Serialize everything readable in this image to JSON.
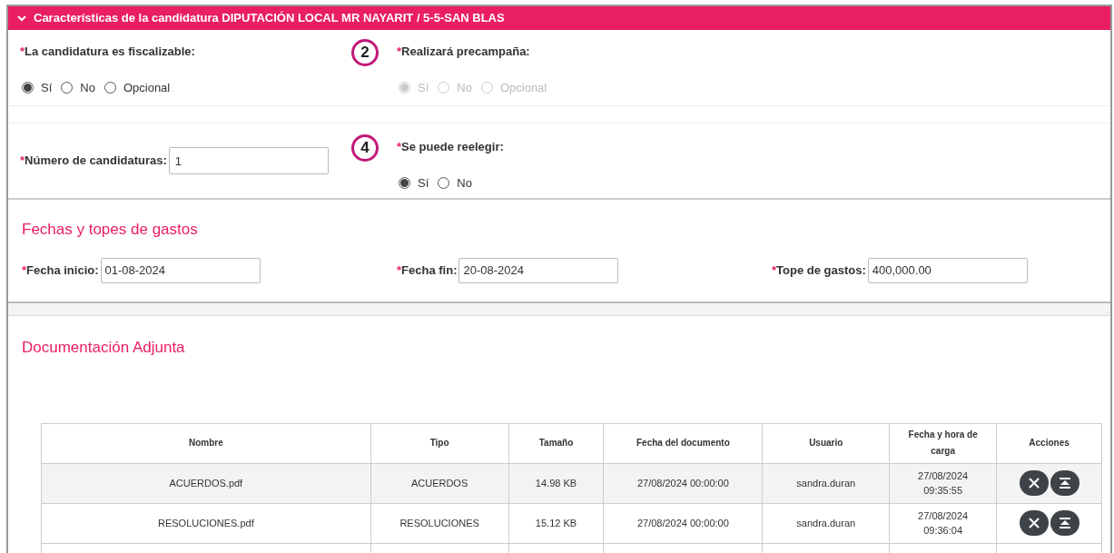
{
  "panel": {
    "title": "Características de la candidatura DIPUTACIÓN LOCAL MR NAYARIT / 5-5-SAN BLAS",
    "expanded": true
  },
  "questions_row1": [
    {
      "kind": "radio",
      "label": "La candidatura es fiscalizable:",
      "required_mark": "*",
      "disabled": false,
      "options": [
        {
          "label": "Sí",
          "selected": true
        },
        {
          "label": "No",
          "selected": false
        },
        {
          "label": "Opcional",
          "selected": false
        }
      ]
    },
    {
      "kind": "radio",
      "marker": "2",
      "label": "Realizará precampaña:",
      "required_mark": "*",
      "disabled": true,
      "options": [
        {
          "label": "Sí",
          "selected": true
        },
        {
          "label": "No",
          "selected": false
        },
        {
          "label": "Opcional",
          "selected": false
        }
      ]
    }
  ],
  "questions_row2": [
    {
      "kind": "input",
      "label": "Número de candidaturas:",
      "required_mark": "*",
      "value": "1"
    },
    {
      "kind": "radio",
      "marker": "4",
      "label": "Se puede reelegir:",
      "required_mark": "*",
      "disabled": false,
      "options": [
        {
          "label": "Sí",
          "selected": true
        },
        {
          "label": "No",
          "selected": false
        }
      ]
    }
  ],
  "fechas": {
    "title": "Fechas y topes de gastos",
    "fields": [
      {
        "label": "Fecha inicio:",
        "required_mark": "*",
        "value": "01-08-2024"
      },
      {
        "label": "Fecha fin:",
        "required_mark": "*",
        "value": "20-08-2024"
      },
      {
        "label": "Tope de gastos:",
        "required_mark": "*",
        "value": "400,000.00"
      }
    ]
  },
  "documentacion": {
    "title": "Documentación Adjunta",
    "table": {
      "columns": [
        "Nombre",
        "Tipo",
        "Tamaño",
        "Fecha del documento",
        "Usuario",
        "Fecha y hora de carga",
        "Acciones"
      ],
      "rows": [
        {
          "cells": [
            "ACUERDOS.pdf",
            "ACUERDOS",
            "14.98 KB",
            "27/08/2024 00:00:00",
            "sandra.duran",
            "27/08/2024 09:35:55"
          ]
        },
        {
          "cells": [
            "RESOLUCIONES.pdf",
            "RESOLUCIONES",
            "15.12 KB",
            "27/08/2024 00:00:00",
            "sandra.duran",
            "27/08/2024 09:36:04"
          ]
        }
      ]
    }
  }
}
